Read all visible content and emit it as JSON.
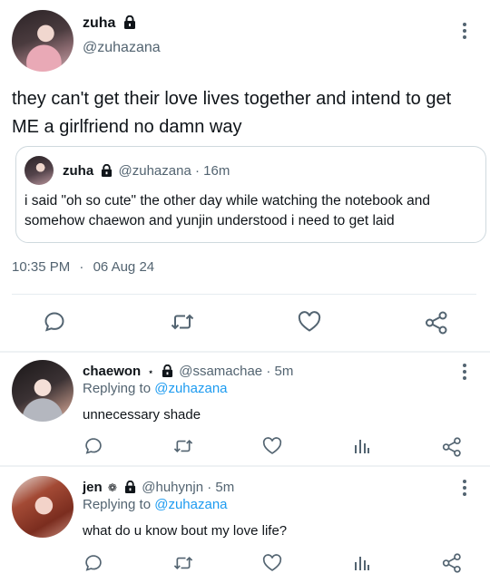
{
  "main_tweet": {
    "name": "zuha",
    "handle": "@zuhazana",
    "text": "they can't get their love lives together and intend to get ME a girlfriend no damn way",
    "time": "10:35 PM",
    "separator": "·",
    "date": "06 Aug 24"
  },
  "quoted_tweet": {
    "name": "zuha",
    "handle": "@zuhazana",
    "separator": "·",
    "age": "16m",
    "text": "i said \"oh so cute\" the other day while watching the notebook and somehow chaewon and yunjin understood i need to get laid"
  },
  "replies": [
    {
      "name": "chaewon",
      "badge": "⋆",
      "handle": "@ssamachae",
      "separator": "·",
      "age": "5m",
      "replying_label": "Replying to",
      "replying_handle": "@zuhazana",
      "text": "unnecessary shade"
    },
    {
      "name": "jen",
      "badge": "❁",
      "handle": "@huhynjn",
      "separator": "·",
      "age": "5m",
      "replying_label": "Replying to",
      "replying_handle": "@zuhazana",
      "text": "what do u know bout my love life?"
    }
  ],
  "icons": [
    "more-icon",
    "lock-icon",
    "reply-icon",
    "retweet-icon",
    "like-icon",
    "share-icon",
    "analytics-icon"
  ],
  "colors": {
    "text": "#0f1419",
    "secondary": "#536471",
    "link": "#1d9bf0",
    "border": "#cfd9de"
  }
}
